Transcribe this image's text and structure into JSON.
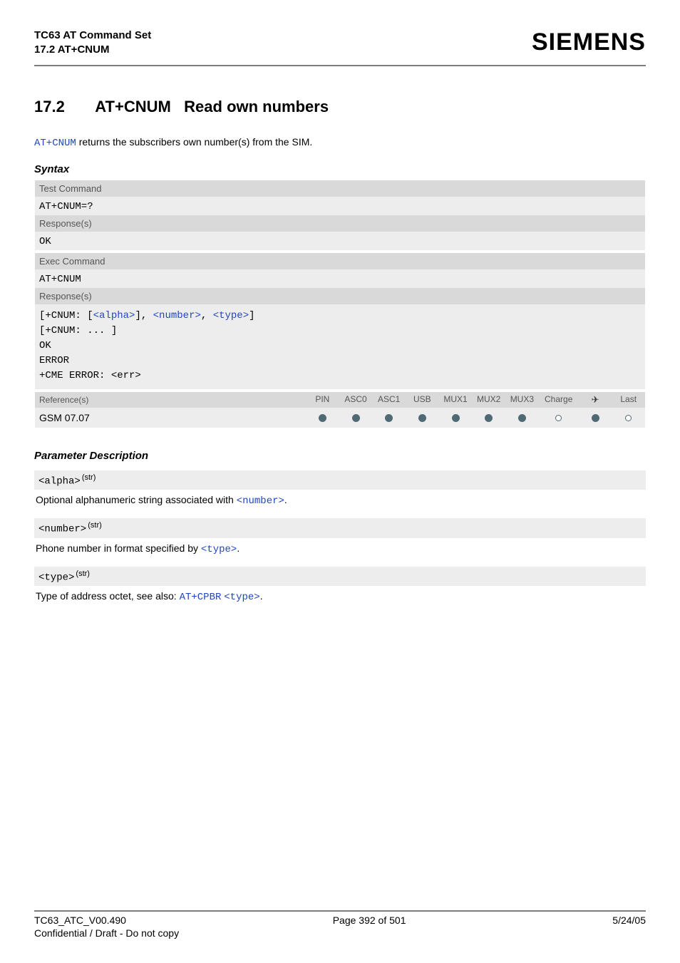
{
  "header": {
    "title_line1": "TC63 AT Command Set",
    "title_line2": "17.2 AT+CNUM",
    "brand": "SIEMENS"
  },
  "section": {
    "number": "17.2",
    "command": "AT+CNUM",
    "title_rest": "Read own numbers"
  },
  "intro": {
    "cmd": "AT+CNUM",
    "text_after": " returns the subscribers own number(s) from the SIM."
  },
  "syntax_label": "Syntax",
  "syntax": {
    "test_label": "Test Command",
    "test_cmd": "AT+CNUM=?",
    "response_label": "Response(s)",
    "ok": "OK",
    "exec_label": "Exec Command",
    "exec_cmd": "AT+CNUM",
    "resp_lines": {
      "l1_open": "[",
      "l1_tag": "+CNUM: ",
      "l1_b_open": "[",
      "l1_alpha": "<alpha>",
      "l1_b_close": "]",
      "l1_comma1": ", ",
      "l1_number": "<number>",
      "l1_comma2": ", ",
      "l1_type": "<type>",
      "l1_close": "]",
      "l2": "[+CNUM: ... ]",
      "l3": "OK",
      "l4": "ERROR",
      "l5_a": "+CME ERROR: ",
      "l5_b": "<err>"
    },
    "ref_label": "Reference(s)",
    "cols": [
      "PIN",
      "ASC0",
      "ASC1",
      "USB",
      "MUX1",
      "MUX2",
      "MUX3",
      "Charge",
      "✈",
      "Last"
    ],
    "gsm": "GSM 07.07",
    "dots": [
      "f",
      "f",
      "f",
      "f",
      "f",
      "f",
      "f",
      "e",
      "f",
      "e"
    ]
  },
  "param_desc_label": "Parameter Description",
  "params": {
    "alpha": {
      "name": "<alpha>",
      "sup": "(str)",
      "text_before": "Optional alphanumeric string associated with ",
      "link": "<number>",
      "text_after": "."
    },
    "number": {
      "name": "<number>",
      "sup": "(str)",
      "text_before": "Phone number in format specified by ",
      "link": "<type>",
      "text_after": "."
    },
    "type": {
      "name": "<type>",
      "sup": "(str)",
      "text_before": "Type of address octet, see also: ",
      "link1": "AT+CPBR",
      "space": " ",
      "link2": "<type>",
      "text_after": "."
    }
  },
  "footer": {
    "left": "TC63_ATC_V00.490",
    "center": "Page 392 of 501",
    "right": "5/24/05",
    "sub": "Confidential / Draft - Do not copy"
  }
}
